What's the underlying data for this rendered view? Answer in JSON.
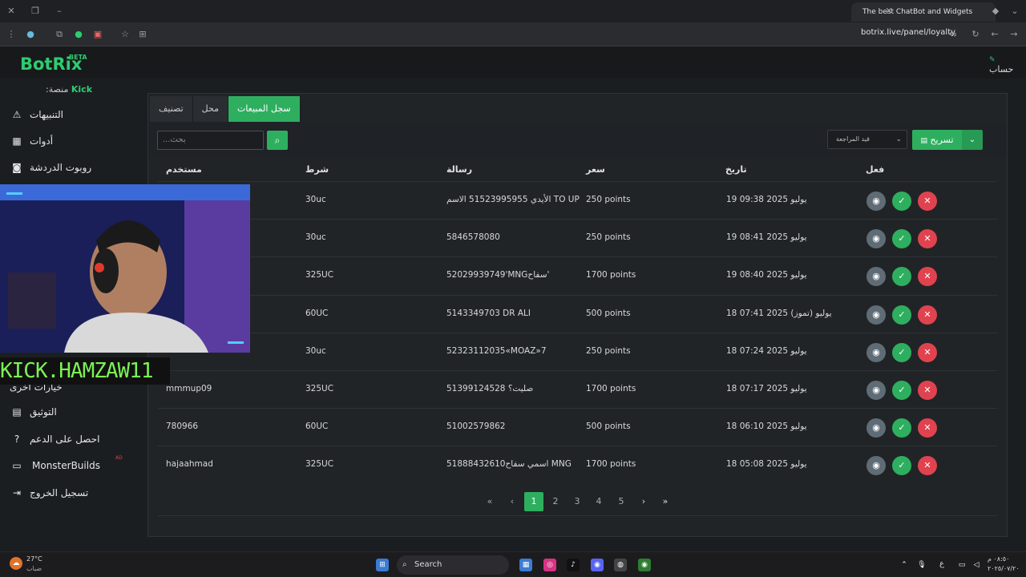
{
  "browser": {
    "tab_title": "The best ChatBot and Widgets",
    "url": "botrix.live/panel/loyalty"
  },
  "app": {
    "logo": "BotRix",
    "beta": "BETA",
    "account": "حساب",
    "platform_label": ":منصة",
    "platform_value": "Kick"
  },
  "sidebar": {
    "items": [
      {
        "label": "التنبيهات",
        "icon": "warning-icon"
      },
      {
        "label": "أدوات",
        "icon": "grid-icon"
      },
      {
        "label": "روبوت الدردشة",
        "icon": "robot-icon"
      },
      {
        "label": "التوثيق",
        "icon": "doc-icon"
      },
      {
        "label": "احصل على الدعم",
        "icon": "help-icon"
      },
      {
        "label": "MonsterBuilds",
        "icon": "monitor-icon",
        "badge": "AD"
      },
      {
        "label": "تسجيل الخروج",
        "icon": "logout-icon"
      }
    ]
  },
  "tabs": [
    "سجل المبيعات",
    "محل",
    "تصنيف"
  ],
  "toolbar": {
    "search_placeholder": "...بحث",
    "filter_label": "قيد المراجعة",
    "export_label": "تسريح"
  },
  "table": {
    "headers": {
      "action": "فعل",
      "date": "تاريخ",
      "price": "سعر",
      "message": "رسالة",
      "condition": "شرط",
      "user": "مستخدم"
    },
    "rows": [
      {
        "date": "يوليو 2025 09:38 19",
        "price": "250 points",
        "message": "الأيدي 51523995955 الاسم TO UP",
        "condition": "30uc",
        "user": ""
      },
      {
        "date": "يوليو 2025 08:41 19",
        "price": "250 points",
        "message": "5846578080",
        "condition": "30uc",
        "user": ""
      },
      {
        "date": "يوليو 2025 08:40 19",
        "price": "1700 points",
        "message": "52029939749'MNGسفاح'",
        "condition": "325UC",
        "user": ""
      },
      {
        "date": "يوليو (تموز) 2025 07:41 18",
        "price": "500 points",
        "message": "5143349703 DR ALI",
        "condition": "60UC",
        "user": ""
      },
      {
        "date": "يوليو 2025 07:24 18",
        "price": "250 points",
        "message": "52323112035«MOAZ»7",
        "condition": "30uc",
        "user": ""
      },
      {
        "date": "يوليو 2025 07:17 18",
        "price": "1700 points",
        "message": "51399124528 صليت؟",
        "condition": "325UC",
        "user": "mmmup09"
      },
      {
        "date": "يوليو 2025 06:10 18",
        "price": "500 points",
        "message": "51002579862",
        "condition": "60UC",
        "user": "780966"
      },
      {
        "date": "يوليو 2025 05:08 18",
        "price": "1700 points",
        "message": "51888432610اسمي سفاح MNG",
        "condition": "325UC",
        "user": "hajaahmad"
      }
    ]
  },
  "pagination": {
    "pages": [
      "1",
      "2",
      "3",
      "4",
      "5"
    ],
    "active": "1"
  },
  "stream_overlay": {
    "name": "KICK.HAMZAW11",
    "partial_menu": "خيارات اخرى"
  },
  "taskbar": {
    "weather_temp": "27°C",
    "weather_desc": "ضباب",
    "search": "Search",
    "time": "٠٨:٥٠ م",
    "date": "٢٠٢٥/٠٧/٢٠",
    "lang": "ع"
  },
  "colors": {
    "accent": "#2eaf5f",
    "danger": "#e0434f",
    "neutral": "#5f6c75"
  }
}
